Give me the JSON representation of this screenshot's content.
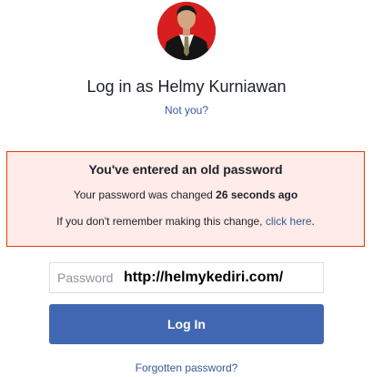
{
  "profile": {
    "title": "Log in as Helmy Kurniawan",
    "not_you": "Not you?"
  },
  "alert": {
    "title": "You've entered an old password",
    "changed_prefix": "Your password was changed ",
    "changed_time": "26 seconds ago",
    "remember_prefix": "If you don't remember making this change, ",
    "remember_link": "click here",
    "remember_suffix": "."
  },
  "password": {
    "placeholder": "Password",
    "overlay_text": "http://helmykediri.com/"
  },
  "login_button": "Log In",
  "forgot_link": "Forgotten password?",
  "colors": {
    "primary": "#4267b2",
    "link": "#365899",
    "alert_border": "#dd3c10",
    "alert_bg": "#ffebe8"
  }
}
